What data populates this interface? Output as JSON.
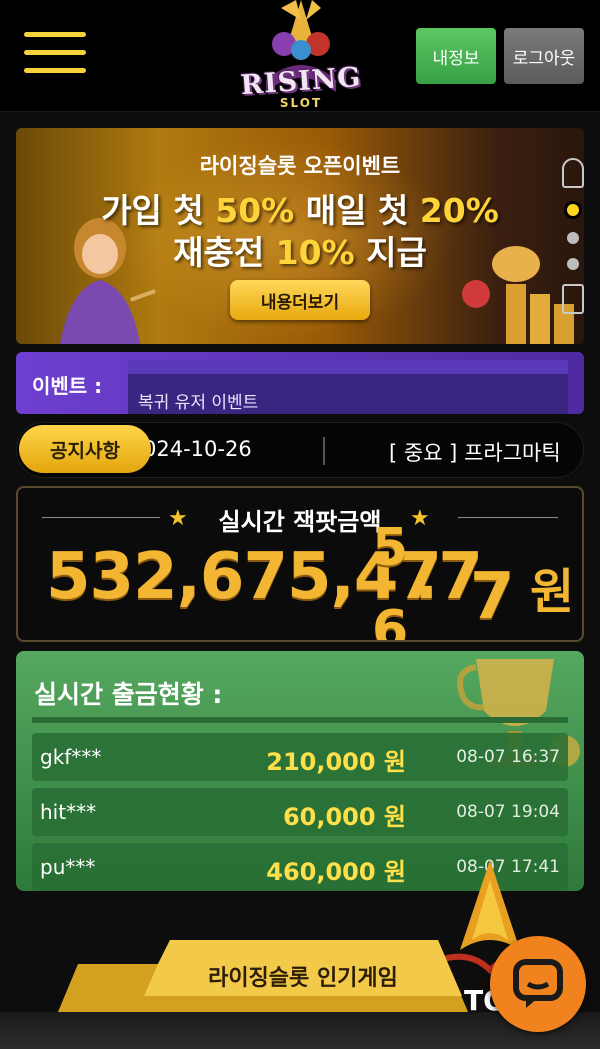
{
  "header": {
    "logo_text": "RISING",
    "logo_sub": "SLOT",
    "my_info_label": "내정보",
    "logout_label": "로그아웃"
  },
  "banner": {
    "subtitle": "라이징슬롯 오픈이벤트",
    "line1_a": "가입 첫 ",
    "line1_b": "50%",
    "line1_c": " 매일 첫 ",
    "line1_d": "20%",
    "line2_a": "재충전 ",
    "line2_b": "10%",
    "line2_c": " 지급",
    "cta_label": "내용더보기",
    "slides": 4,
    "active_slide": 1
  },
  "event": {
    "label": "이벤트 :",
    "text": "복귀 유저 이벤트"
  },
  "notice": {
    "pill_label": "공지사항",
    "date": "024-10-26",
    "title": "[ 중요 ] 프라그마틱"
  },
  "jackpot": {
    "title": "실시간 잭팟금액",
    "amount_main": "532,675,47",
    "roll_top": "5",
    "roll_bottom": "6",
    "amount_dot": ".7",
    "amount_last": "7",
    "unit": "원"
  },
  "withdrawals": {
    "title": "실시간 출금현황 :",
    "rows": [
      {
        "user": "gkf***",
        "amount": "210,000 원",
        "time": "08-07 16:37"
      },
      {
        "user": "hit***",
        "amount": "60,000 원",
        "time": "08-07 19:04"
      },
      {
        "user": "pu***",
        "amount": "460,000 원",
        "time": "08-07 17:41"
      }
    ]
  },
  "bottom": {
    "popular_label": "라이징슬롯 인기게임",
    "top_label": "TO"
  },
  "colors": {
    "accent_yellow": "#ffd43a",
    "green_button": "#4bb456",
    "chat_orange": "#f0831e",
    "event_purple": "#6e3fd0"
  },
  "icons": {
    "menu": "hamburger-icon",
    "chat": "chat-bubble-icon"
  }
}
